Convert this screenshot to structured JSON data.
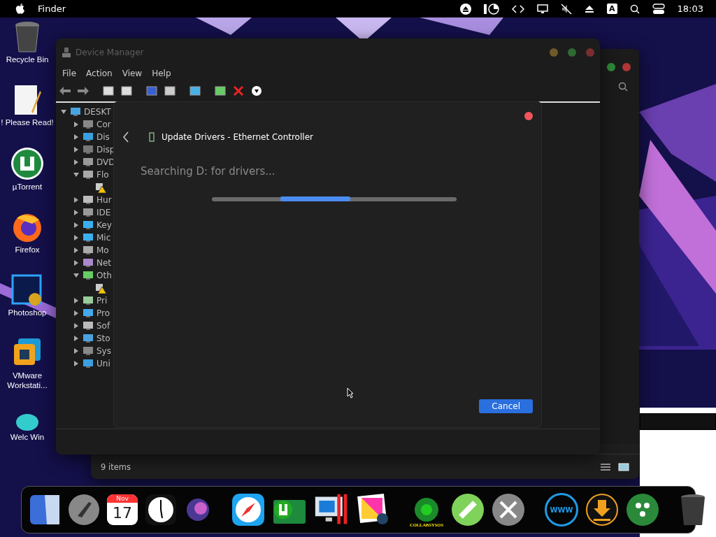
{
  "menu_bar": {
    "app": "Finder",
    "input_source": "A",
    "clock": "18:03"
  },
  "desktop_icons": [
    {
      "label": "Recycle Bin"
    },
    {
      "label": "! Please Read!"
    },
    {
      "label": "µTorrent"
    },
    {
      "label": "Firefox"
    },
    {
      "label": "Photoshop"
    },
    {
      "label": "VMware Workstati..."
    },
    {
      "label": "Welc Win"
    }
  ],
  "device_manager": {
    "title": "Device Manager",
    "menu": [
      "File",
      "Action",
      "View",
      "Help"
    ],
    "tree": [
      {
        "label": "DESKT",
        "expanded": true,
        "children": [
          {
            "label": "Cor",
            "expanded": false
          },
          {
            "label": "Dis",
            "expanded": false
          },
          {
            "label": "Disp",
            "expanded": false
          },
          {
            "label": "DVD",
            "expanded": false
          },
          {
            "label": "Flo",
            "expanded": true,
            "children": [
              {
                "warning": true
              }
            ]
          },
          {
            "label": "Hur",
            "expanded": false
          },
          {
            "label": "IDE",
            "expanded": false
          },
          {
            "label": "Key",
            "expanded": false
          },
          {
            "label": "Mic",
            "expanded": false
          },
          {
            "label": "Mo",
            "expanded": false
          },
          {
            "label": "Net",
            "expanded": false
          },
          {
            "label": "Oth",
            "expanded": true,
            "children": [
              {
                "warning": true
              }
            ]
          },
          {
            "label": "Pri",
            "expanded": false
          },
          {
            "label": "Pro",
            "expanded": false
          },
          {
            "label": "Sof",
            "expanded": false
          },
          {
            "label": "Sto",
            "expanded": false
          },
          {
            "label": "Sys",
            "expanded": false
          },
          {
            "label": "Uni",
            "expanded": false
          }
        ]
      }
    ]
  },
  "dialog": {
    "title": "Update Drivers - Ethernet Controller",
    "status": "Searching D: for drivers...",
    "cancel": "Cancel"
  },
  "back_window": {
    "status": "9 items"
  },
  "dock": {
    "calendar_month": "Nov",
    "calendar_day": "17",
    "collabsysos_label": "COLLABSYSOS",
    "globe_label": "WWW"
  }
}
